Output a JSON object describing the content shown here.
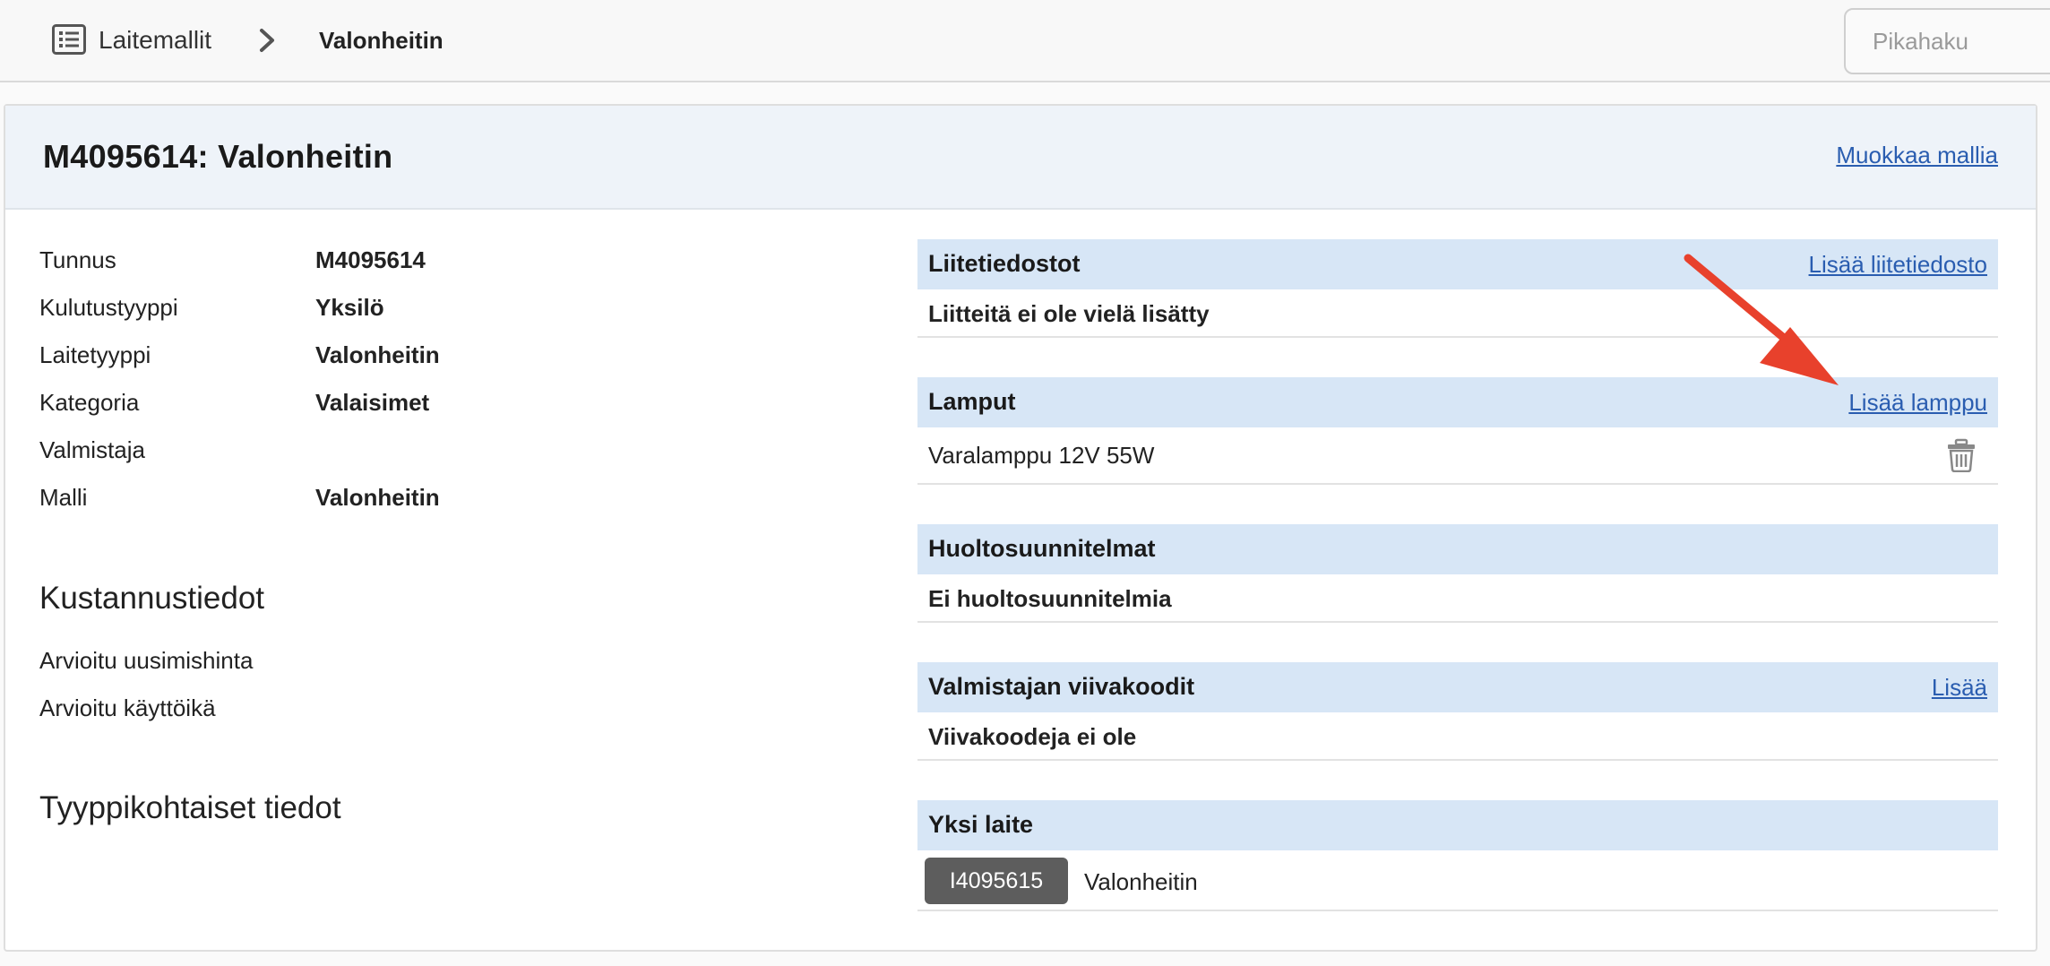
{
  "breadcrumb": {
    "root_label": "Laitemallit",
    "current_label": "Valonheitin"
  },
  "search": {
    "placeholder": "Pikahaku"
  },
  "card": {
    "title": "M4095614: Valonheitin",
    "edit_link": "Muokkaa mallia"
  },
  "details": [
    {
      "label": "Tunnus",
      "value": "M4095614"
    },
    {
      "label": "Kulutustyyppi",
      "value": "Yksilö"
    },
    {
      "label": "Laitetyyppi",
      "value": "Valonheitin"
    },
    {
      "label": "Kategoria",
      "value": "Valaisimet"
    },
    {
      "label": "Valmistaja",
      "value": ""
    },
    {
      "label": "Malli",
      "value": "Valonheitin"
    }
  ],
  "cost_section": {
    "heading": "Kustannustiedot",
    "fields": [
      {
        "label": "Arvioitu uusimishinta"
      },
      {
        "label": "Arvioitu käyttöikä"
      }
    ]
  },
  "type_section": {
    "heading": "Tyyppikohtaiset tiedot"
  },
  "panels": {
    "attachments": {
      "title": "Liitetiedostot",
      "link": "Lisää liitetiedosto",
      "empty": "Liitteitä ei ole vielä lisätty"
    },
    "lamps": {
      "title": "Lamput",
      "link": "Lisää lamppu",
      "items": [
        "Varalamppu 12V 55W"
      ]
    },
    "maintenance": {
      "title": "Huoltosuunnitelmat",
      "empty": "Ei huoltosuunnitelmia"
    },
    "barcodes": {
      "title": "Valmistajan viivakoodit",
      "link": "Lisää",
      "empty": "Viivakoodeja ei ole"
    },
    "devices": {
      "title": "Yksi laite",
      "items": [
        {
          "id": "I4095615",
          "name": "Valonheitin"
        }
      ]
    }
  },
  "colors": {
    "accent_link": "#2a5db0",
    "panel_header": "#d7e6f6",
    "annotation_arrow": "#e8412c"
  },
  "icons": [
    "list-icon",
    "chevron-right-icon",
    "trash-icon",
    "arrow-annotation"
  ]
}
